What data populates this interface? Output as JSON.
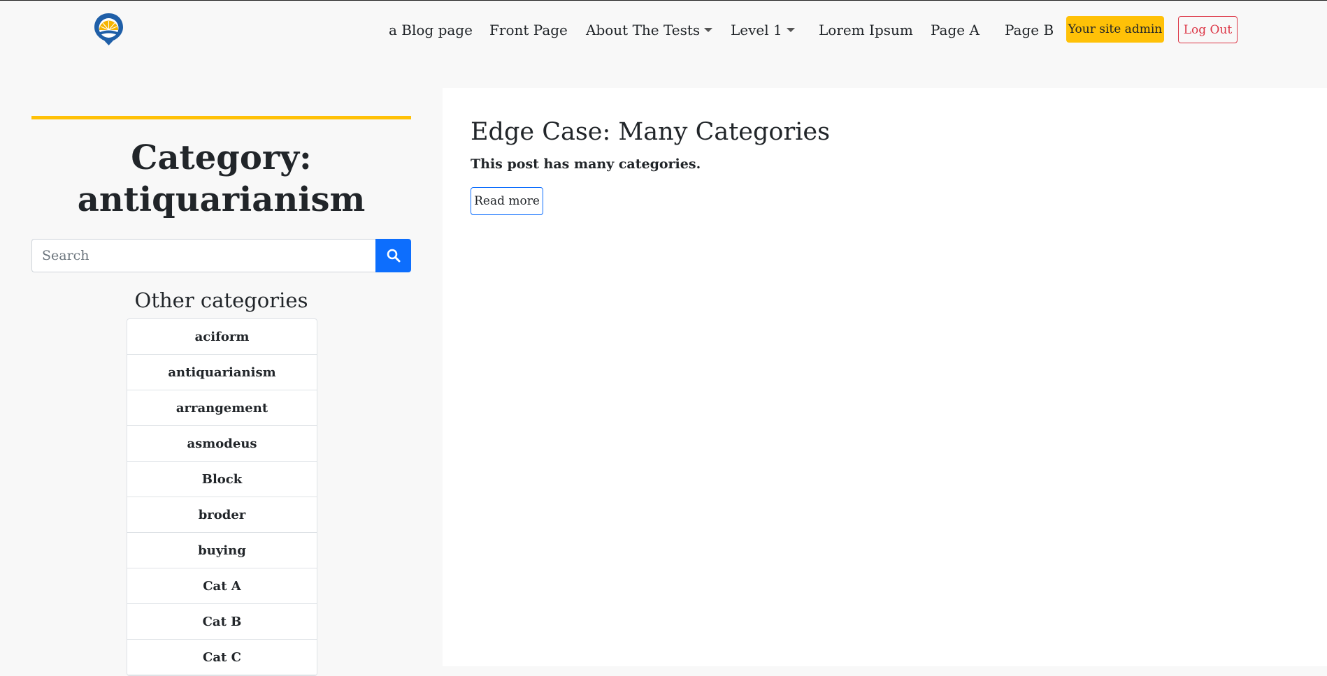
{
  "nav": {
    "items": [
      {
        "label": "a Blog page",
        "dropdown": false
      },
      {
        "label": "Front Page",
        "dropdown": false
      },
      {
        "label": "About The Tests",
        "dropdown": true
      },
      {
        "label": "Level 1",
        "dropdown": true
      },
      {
        "label": "Lorem Ipsum",
        "dropdown": false
      },
      {
        "label": "Page A",
        "dropdown": false
      },
      {
        "label": "Page B",
        "dropdown": false
      }
    ],
    "admin_label": "Your site admin",
    "logout_label": "Log Out"
  },
  "sidebar": {
    "title_line1": "Category:",
    "title_line2": "antiquarianism",
    "search_placeholder": "Search",
    "other_heading": "Other categories",
    "categories": [
      "aciform",
      "antiquarianism",
      "arrangement",
      "asmodeus",
      "Block",
      "broder",
      "buying",
      "Cat A",
      "Cat B",
      "Cat C"
    ]
  },
  "post": {
    "title": "Edge Case: Many Categories",
    "excerpt": "This post has many categories.",
    "read_more": "Read more"
  },
  "colors": {
    "accent": "#ffc107",
    "primary": "#0d6efd",
    "danger": "#dc3545"
  }
}
